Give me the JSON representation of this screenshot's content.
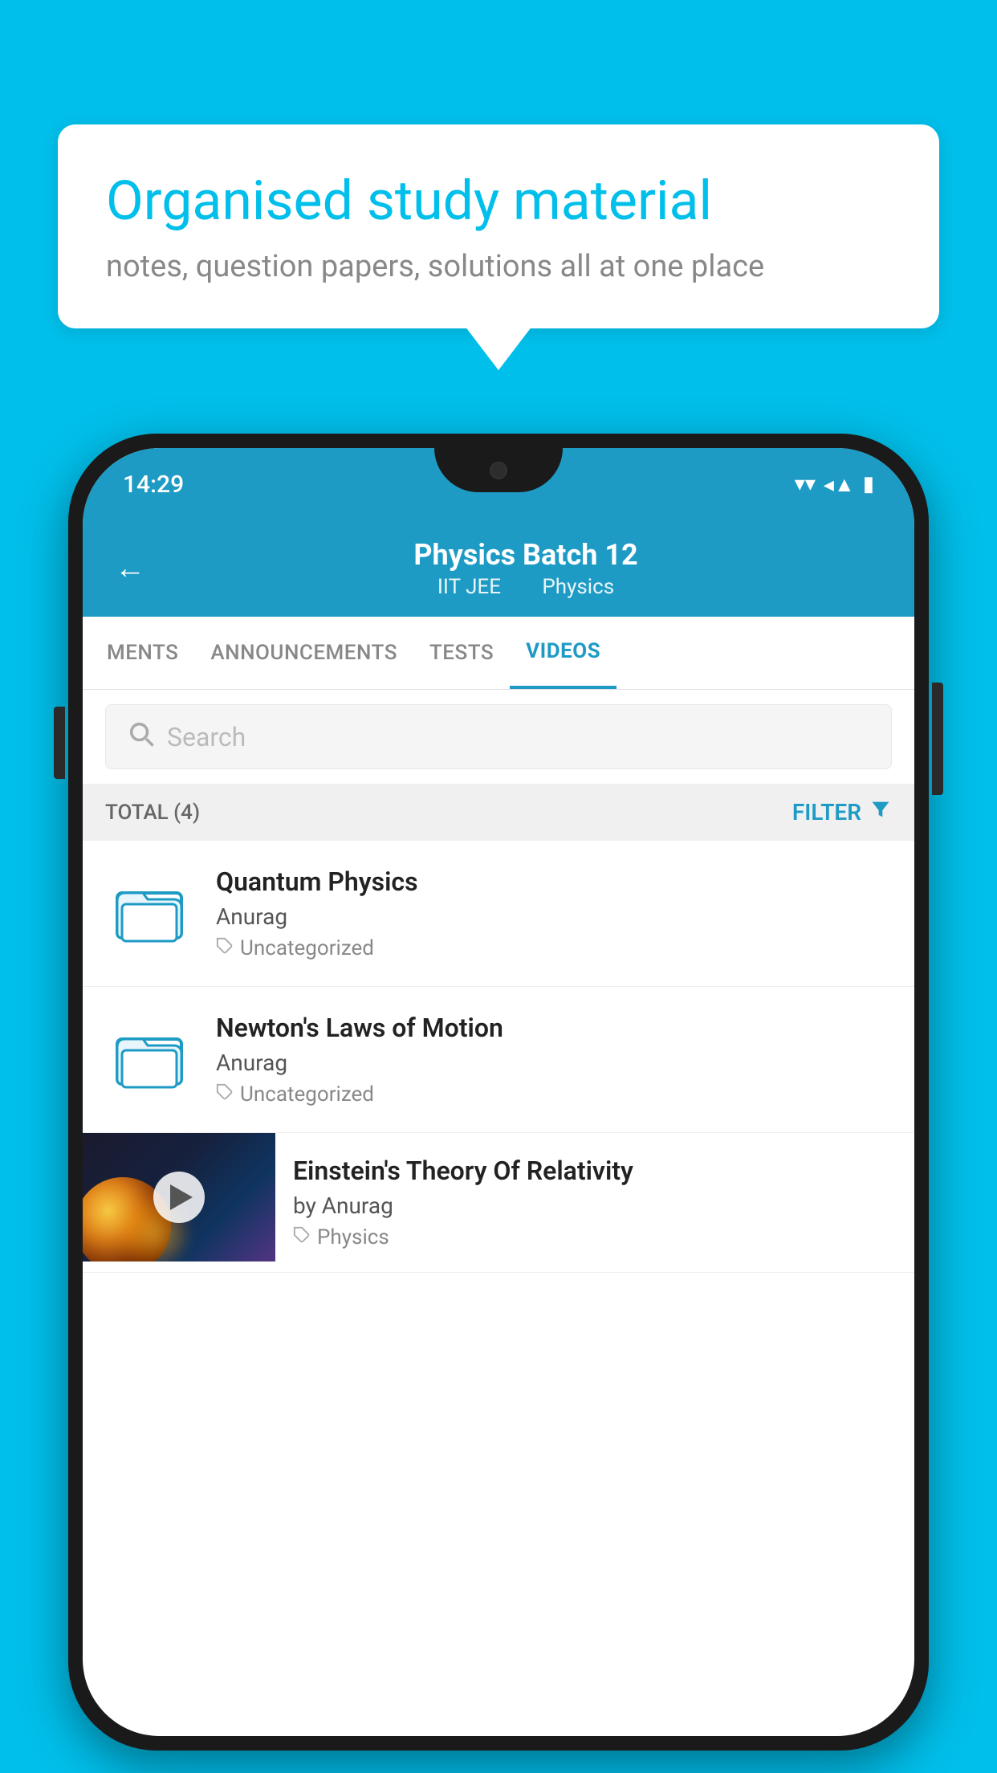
{
  "background_color": "#00BFEA",
  "speech_bubble": {
    "title": "Organised study material",
    "subtitle": "notes, question papers, solutions all at one place"
  },
  "status_bar": {
    "time": "14:29"
  },
  "app_header": {
    "title": "Physics Batch 12",
    "subtitle_parts": [
      "IIT JEE",
      "Physics"
    ]
  },
  "tabs": [
    {
      "label": "MENTS",
      "active": false
    },
    {
      "label": "ANNOUNCEMENTS",
      "active": false
    },
    {
      "label": "TESTS",
      "active": false
    },
    {
      "label": "VIDEOS",
      "active": true
    }
  ],
  "search": {
    "placeholder": "Search"
  },
  "filter_bar": {
    "total_label": "TOTAL (4)",
    "filter_btn": "FILTER"
  },
  "videos": [
    {
      "title": "Quantum Physics",
      "author": "Anurag",
      "tag": "Uncategorized",
      "has_thumbnail": false
    },
    {
      "title": "Newton's Laws of Motion",
      "author": "Anurag",
      "tag": "Uncategorized",
      "has_thumbnail": false
    },
    {
      "title": "Einstein's Theory Of Relativity",
      "author": "by Anurag",
      "tag": "Physics",
      "has_thumbnail": true
    }
  ],
  "icons": {
    "back": "←",
    "filter": "▼",
    "tag": "🏷"
  }
}
